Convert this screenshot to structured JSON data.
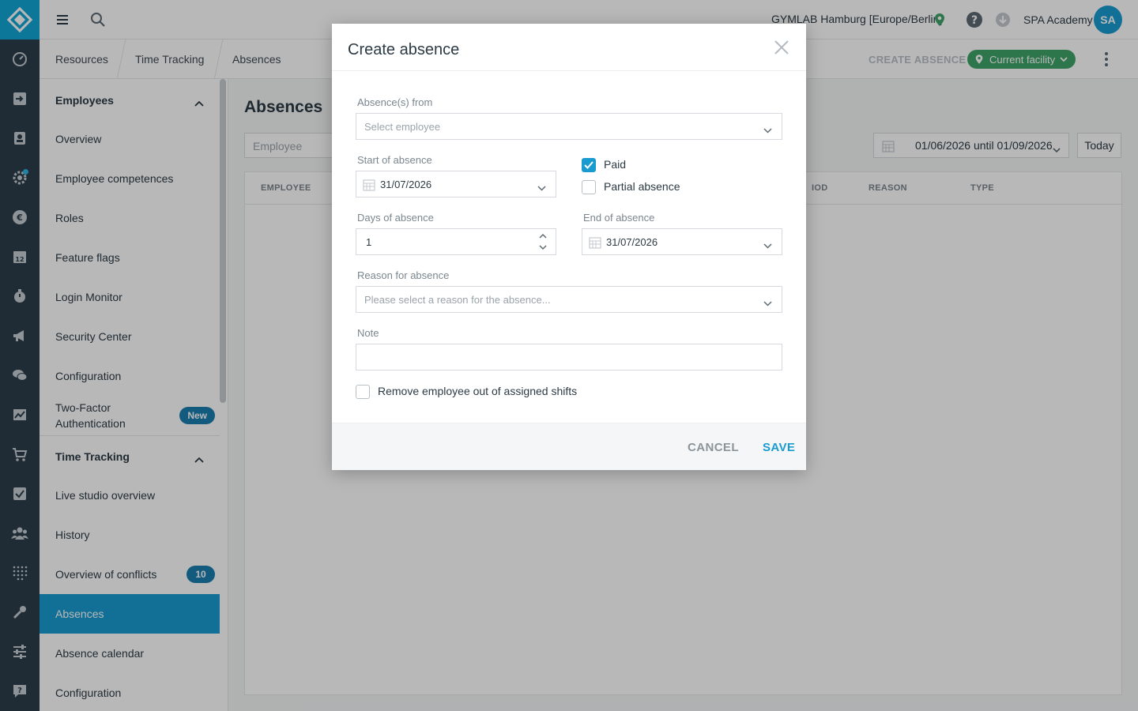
{
  "header": {
    "facility": "GYMLAB Hamburg [Europe/Berlin]",
    "account": "SPA Academy",
    "avatar_initials": "SA"
  },
  "breadcrumb": [
    "Resources",
    "Time Tracking",
    "Absences"
  ],
  "toolbar": {
    "create_absence": "CREATE ABSENCE",
    "facility_filter": "Current facility"
  },
  "sidebar": {
    "sections": [
      {
        "title": "Employees",
        "items": [
          {
            "label": "Overview"
          },
          {
            "label": "Employee competences"
          },
          {
            "label": "Roles"
          },
          {
            "label": "Feature flags"
          },
          {
            "label": "Login Monitor"
          },
          {
            "label": "Security Center"
          },
          {
            "label": "Configuration"
          },
          {
            "label": "Two-Factor Authentication",
            "badge": "New"
          }
        ]
      },
      {
        "title": "Time Tracking",
        "items": [
          {
            "label": "Live studio overview"
          },
          {
            "label": "History"
          },
          {
            "label": "Overview of conflicts",
            "badge": "10"
          },
          {
            "label": "Absences",
            "active": true
          },
          {
            "label": "Absence calendar"
          },
          {
            "label": "Configuration"
          }
        ]
      }
    ]
  },
  "main": {
    "title": "Absences",
    "employee_filter_placeholder": "Employee",
    "date_range": "01/06/2026 until 01/09/2026",
    "today_label": "Today",
    "columns": [
      "EMPLOYEE",
      "IOD",
      "REASON",
      "TYPE"
    ]
  },
  "modal": {
    "title": "Create absence",
    "absence_from_label": "Absence(s) from",
    "absence_from_placeholder": "Select employee",
    "start_label": "Start of absence",
    "start_value": "31/07/2026",
    "paid_label": "Paid",
    "paid_checked": true,
    "partial_label": "Partial absence",
    "partial_checked": false,
    "days_label": "Days of absence",
    "days_value": "1",
    "end_label": "End of absence",
    "end_value": "31/07/2026",
    "reason_label": "Reason for absence",
    "reason_placeholder": "Please select a reason for the absence...",
    "note_label": "Note",
    "note_value": "",
    "remove_label": "Remove employee out of assigned shifts",
    "remove_checked": false,
    "cancel": "CANCEL",
    "save": "SAVE"
  },
  "colors": {
    "accent": "#1a9bd0",
    "rail": "#2c3e4c",
    "facility_chip": "#3fa46a",
    "location_pin": "#3fa46a"
  },
  "icons": {
    "rail": [
      "logo-icon",
      "dashboard-icon",
      "checkin-icon",
      "contacts-icon",
      "settings-icon",
      "euro-icon",
      "calendar-icon",
      "timer-icon",
      "megaphone-icon",
      "chat-icon",
      "chart-icon",
      "cart-icon",
      "checkbox-icon",
      "people-icon",
      "apps-grid-icon",
      "tools-icon",
      "sliders-icon",
      "support-icon"
    ]
  }
}
